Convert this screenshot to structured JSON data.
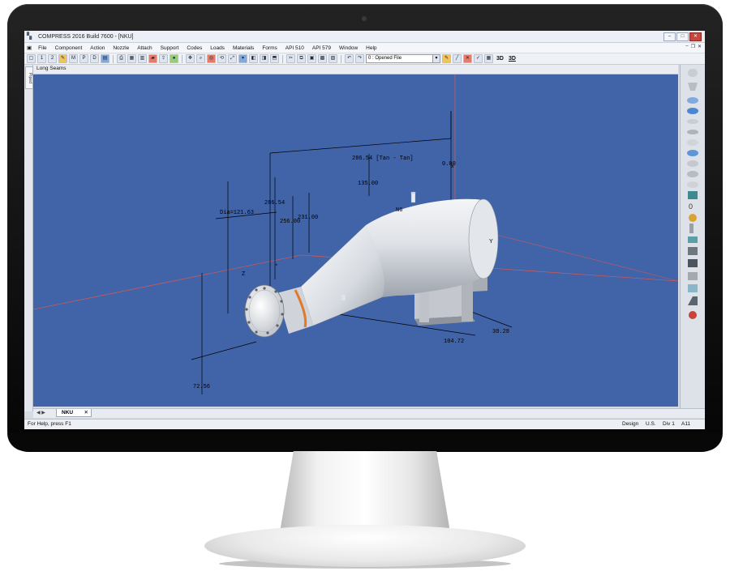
{
  "window": {
    "title": "COMPRESS 2016 Build 7600 - [NKU]"
  },
  "menu": [
    "File",
    "Component",
    "Action",
    "Nozzle",
    "Attach",
    "Support",
    "Codes",
    "Loads",
    "Materials",
    "Forms",
    "API 510",
    "API 579",
    "Window",
    "Help"
  ],
  "toolbar": {
    "combo_value": "0 : Opened File",
    "view_3d_label": "3D",
    "view_3d_alt_label": "3D"
  },
  "side_tab": "Piped",
  "view_header": "Long Seams",
  "dimensions": {
    "tan_tan": "286.54 [Tan - Tan]",
    "overall": "286.54",
    "d1": "256.00",
    "d2": "231.00",
    "d3": "135.00",
    "d4": "0.00",
    "dia": "Dia=121.63",
    "saddle_spacing": "104.72",
    "saddle_offset": "30.28",
    "vertical": "72.56",
    "nozzle_tag": "N6"
  },
  "doc_tab": {
    "label": "NKU",
    "close": "✕"
  },
  "status": {
    "help": "For Help, press F1",
    "design": "Design",
    "units": "U.S.",
    "division": "Div 1",
    "addenda": "A11"
  },
  "colors": {
    "viewport_bg": "#4163a8",
    "vessel": "#d9dde3",
    "ring_accent": "#e07a2a"
  }
}
